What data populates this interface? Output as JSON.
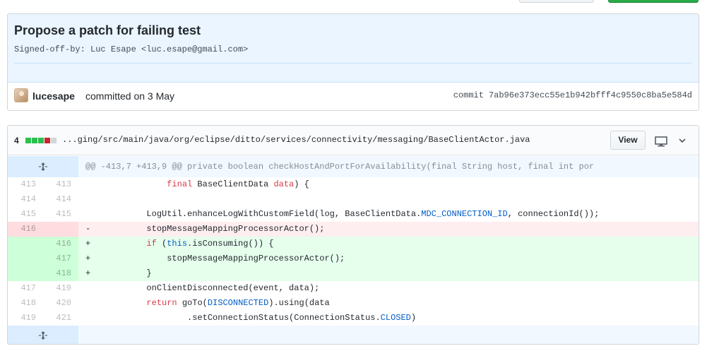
{
  "commit": {
    "title": "Propose a patch for failing test",
    "description": "Signed-off-by: Luc Esape <luc.esape@gmail.com>",
    "author": "lucesape",
    "committed_text": "committed on 3 May",
    "sha_label": "commit",
    "sha": "7ab96e373ecc55e1b942bfff4c9550c8ba5e584d"
  },
  "file": {
    "changes": "4",
    "diffstat": [
      {
        "color": "#2cbe4e"
      },
      {
        "color": "#2cbe4e"
      },
      {
        "color": "#2cbe4e"
      },
      {
        "color": "#cb2431"
      },
      {
        "color": "#d1d5da"
      }
    ],
    "path": "...ging/src/main/java/org/eclipse/ditto/services/connectivity/messaging/BaseClientActor.java",
    "view_label": "View",
    "monitor_icon": "monitor-icon",
    "chevron_icon": "chevron-down-icon"
  },
  "diff": {
    "hunk_header": "@@ -413,7 +413,9 @@ private boolean checkHostAndPortForAvailability(final String host, final int por",
    "rows": [
      {
        "type": "ctx",
        "old": "413",
        "new": "413",
        "parts": [
          {
            "t": "                "
          },
          {
            "t": "final",
            "c": "kw"
          },
          {
            "t": " BaseClientData "
          },
          {
            "t": "data",
            "c": "kw"
          },
          {
            "t": ") {"
          }
        ]
      },
      {
        "type": "ctx",
        "old": "414",
        "new": "414",
        "parts": [
          {
            "t": ""
          }
        ]
      },
      {
        "type": "ctx",
        "old": "415",
        "new": "415",
        "parts": [
          {
            "t": "            LogUtil.enhanceLogWithCustomField(log, BaseClientData."
          },
          {
            "t": "MDC_CONNECTION_ID",
            "c": "const"
          },
          {
            "t": ", connectionId());"
          }
        ]
      },
      {
        "type": "del",
        "old": "416",
        "new": "",
        "parts": [
          {
            "t": "-           stopMessageMappingProcessorActor();"
          }
        ]
      },
      {
        "type": "add",
        "old": "",
        "new": "416",
        "parts": [
          {
            "t": "+           "
          },
          {
            "t": "if",
            "c": "kw"
          },
          {
            "t": " ("
          },
          {
            "t": "this",
            "c": "const"
          },
          {
            "t": ".isConsuming()) {"
          }
        ]
      },
      {
        "type": "add",
        "old": "",
        "new": "417",
        "parts": [
          {
            "t": "+               stopMessageMappingProcessorActor();"
          }
        ]
      },
      {
        "type": "add",
        "old": "",
        "new": "418",
        "parts": [
          {
            "t": "+           }"
          }
        ]
      },
      {
        "type": "ctx",
        "old": "417",
        "new": "419",
        "parts": [
          {
            "t": "            onClientDisconnected(event, data);"
          }
        ]
      },
      {
        "type": "ctx",
        "old": "418",
        "new": "420",
        "parts": [
          {
            "t": "            "
          },
          {
            "t": "return",
            "c": "kw"
          },
          {
            "t": " goTo("
          },
          {
            "t": "DISCONNECTED",
            "c": "const"
          },
          {
            "t": ").using(data"
          }
        ]
      },
      {
        "type": "ctx",
        "old": "419",
        "new": "421",
        "parts": [
          {
            "t": "                    .setConnectionStatus(ConnectionStatus."
          },
          {
            "t": "CLOSED",
            "c": "const"
          },
          {
            "t": ")"
          }
        ]
      }
    ],
    "expand_icon": "unfold-icon"
  }
}
